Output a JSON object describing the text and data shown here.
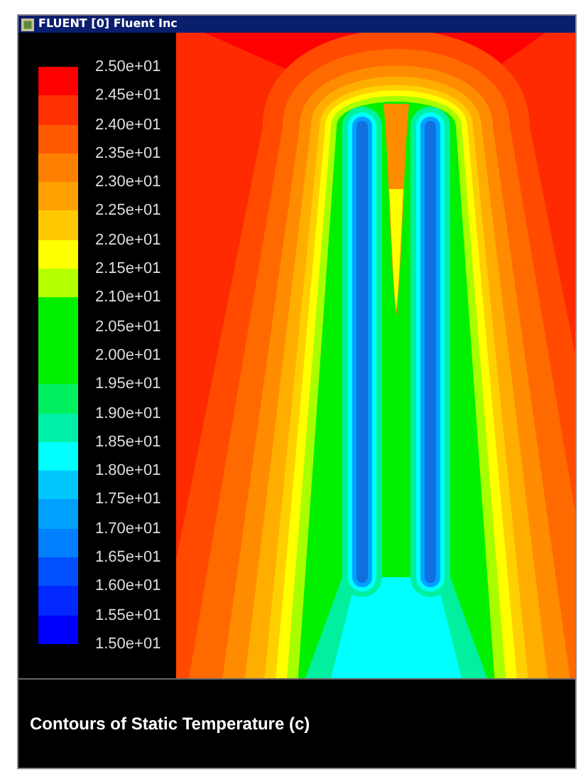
{
  "window": {
    "title": "FLUENT [0] Fluent Inc"
  },
  "legend": {
    "bands": [
      {
        "color": "#ff0000"
      },
      {
        "color": "#ff3000"
      },
      {
        "color": "#ff5a00"
      },
      {
        "color": "#ff8000"
      },
      {
        "color": "#ffa000"
      },
      {
        "color": "#ffc800"
      },
      {
        "color": "#ffff00"
      },
      {
        "color": "#b4ff00"
      },
      {
        "color": "#00f000"
      },
      {
        "color": "#00f000"
      },
      {
        "color": "#00f000"
      },
      {
        "color": "#00f060"
      },
      {
        "color": "#00f0a8"
      },
      {
        "color": "#00ffff"
      },
      {
        "color": "#00c8ff"
      },
      {
        "color": "#00a0ff"
      },
      {
        "color": "#0080ff"
      },
      {
        "color": "#0050ff"
      },
      {
        "color": "#0028ff"
      },
      {
        "color": "#0000ff"
      }
    ],
    "labels": [
      "2.50e+01",
      "2.45e+01",
      "2.40e+01",
      "2.35e+01",
      "2.30e+01",
      "2.25e+01",
      "2.20e+01",
      "2.15e+01",
      "2.10e+01",
      "2.05e+01",
      "2.00e+01",
      "1.95e+01",
      "1.90e+01",
      "1.85e+01",
      "1.80e+01",
      "1.75e+01",
      "1.70e+01",
      "1.65e+01",
      "1.60e+01",
      "1.55e+01",
      "1.50e+01"
    ]
  },
  "caption": "Contours of Static Temperature (c)"
}
